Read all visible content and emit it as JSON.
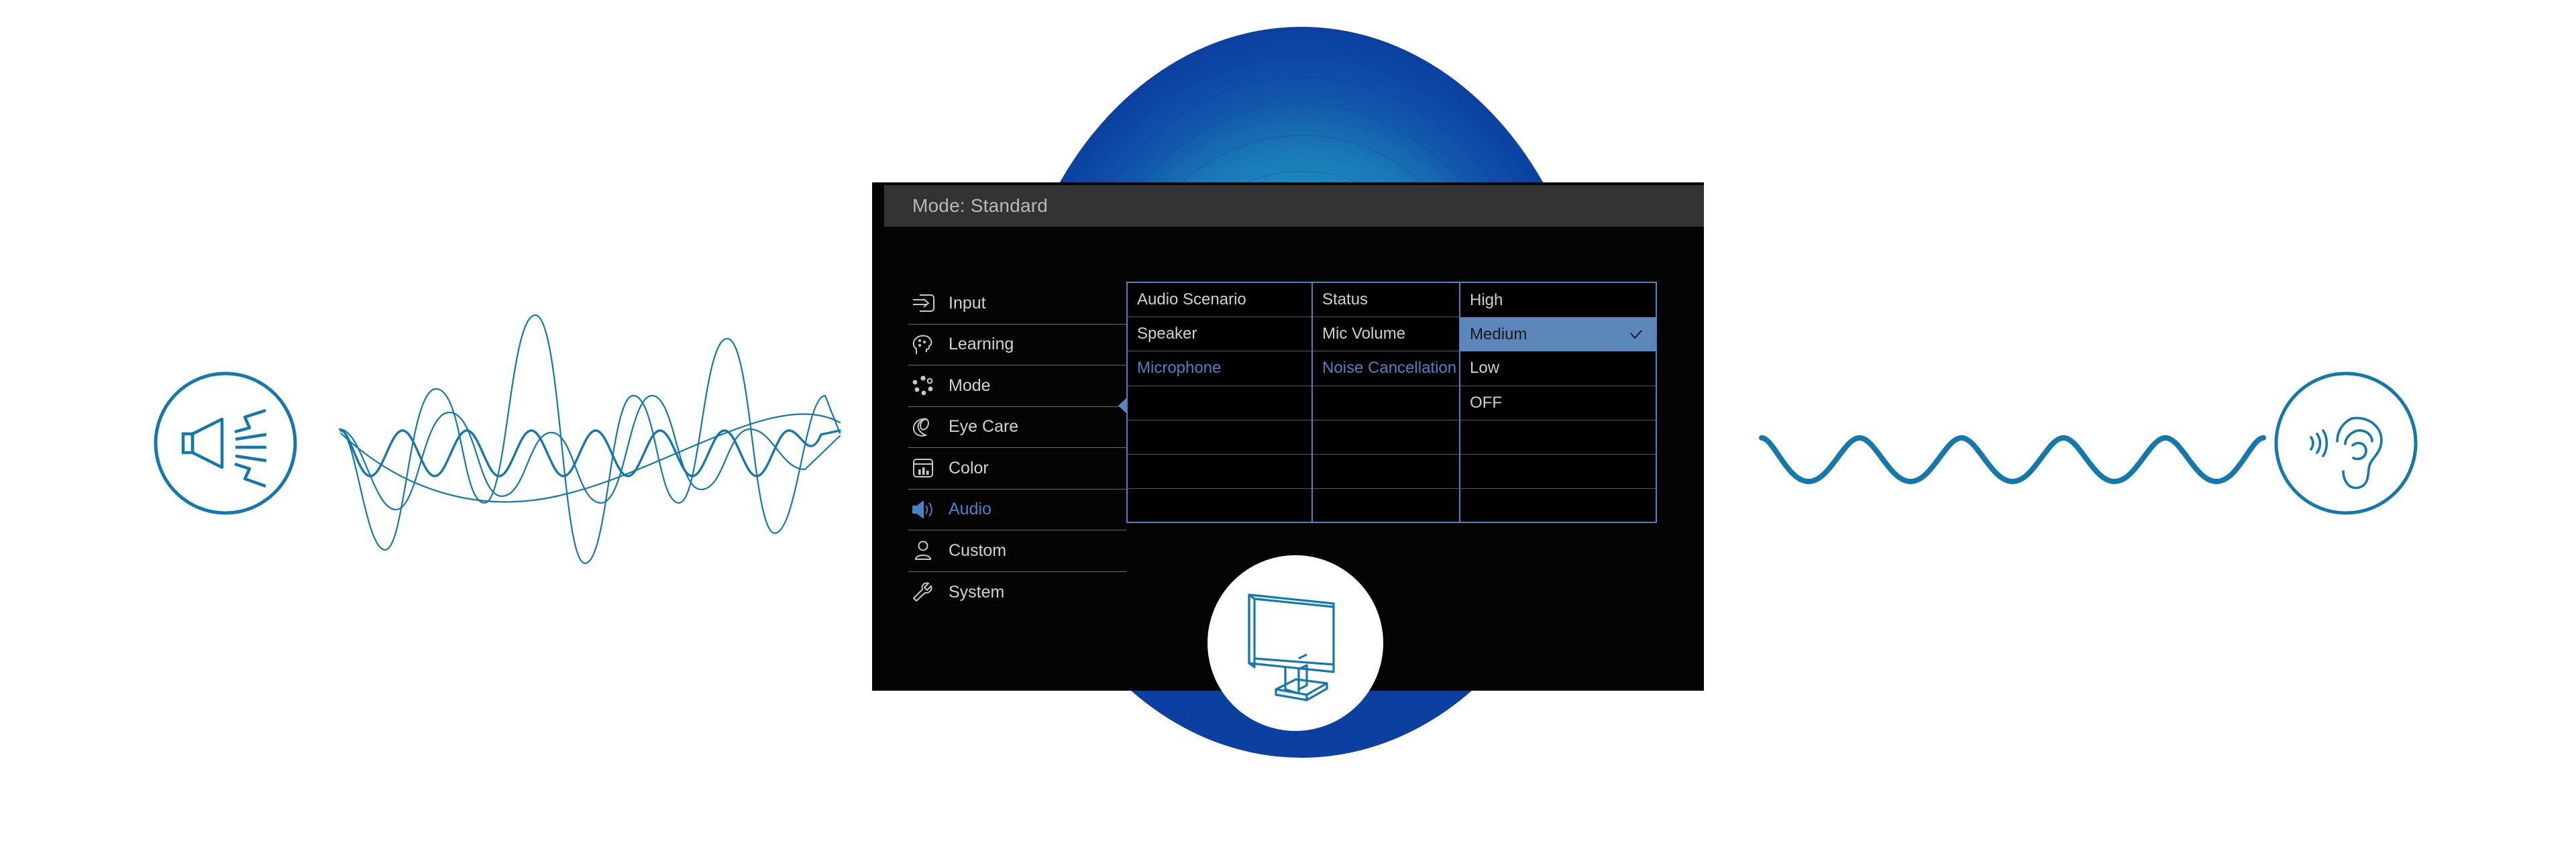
{
  "osd": {
    "title": "Mode: Standard",
    "sidebar": [
      {
        "label": "Input",
        "icon": "input-arrow-icon",
        "active": false
      },
      {
        "label": "Learning",
        "icon": "head-learning-icon",
        "active": false
      },
      {
        "label": "Mode",
        "icon": "dots-circle-icon",
        "active": false
      },
      {
        "label": "Eye Care",
        "icon": "eye-care-icon",
        "active": false
      },
      {
        "label": "Color",
        "icon": "color-bars-icon",
        "active": false
      },
      {
        "label": "Audio",
        "icon": "speaker-icon",
        "active": true
      },
      {
        "label": "Custom",
        "icon": "user-icon",
        "active": false
      },
      {
        "label": "System",
        "icon": "wrench-icon",
        "active": false
      }
    ],
    "column1": [
      {
        "label": "Audio Scenario",
        "state": "normal"
      },
      {
        "label": "Speaker",
        "state": "normal"
      },
      {
        "label": "Microphone",
        "state": "selected"
      },
      {
        "label": "",
        "state": "empty"
      },
      {
        "label": "",
        "state": "empty"
      },
      {
        "label": "",
        "state": "empty"
      },
      {
        "label": "",
        "state": "empty"
      }
    ],
    "column2": [
      {
        "label": "Status",
        "state": "normal"
      },
      {
        "label": "Mic Volume",
        "state": "normal"
      },
      {
        "label": "Noise Cancellation",
        "state": "selected"
      },
      {
        "label": "",
        "state": "empty"
      },
      {
        "label": "",
        "state": "empty"
      },
      {
        "label": "",
        "state": "empty"
      },
      {
        "label": "",
        "state": "empty"
      }
    ],
    "column3": [
      {
        "label": "High",
        "state": "normal",
        "checked": false
      },
      {
        "label": "Medium",
        "state": "highlight",
        "checked": true
      },
      {
        "label": "Low",
        "state": "normal",
        "checked": false
      },
      {
        "label": "OFF",
        "state": "normal",
        "checked": false
      },
      {
        "label": "",
        "state": "empty",
        "checked": false
      },
      {
        "label": "",
        "state": "empty",
        "checked": false
      },
      {
        "label": "",
        "state": "empty",
        "checked": false
      }
    ]
  },
  "illustration": {
    "speaker_icon": "speaker-sound-icon",
    "ear_icon": "ear-listening-icon",
    "monitor_icon": "monitor-icon",
    "noisy_wave": "noisy-audio-waveform",
    "clean_wave": "clean-audio-waveform"
  },
  "colors": {
    "accent_blue": "#4a82c4",
    "highlight_blue": "#5b87ba",
    "brand_blue": "#1378ab",
    "sphere_inner": "#1593c8",
    "sphere_outer": "#0b3fa0",
    "panel_bg": "#040404",
    "header_bg": "#333333",
    "text_gray": "#cfcfcf"
  }
}
